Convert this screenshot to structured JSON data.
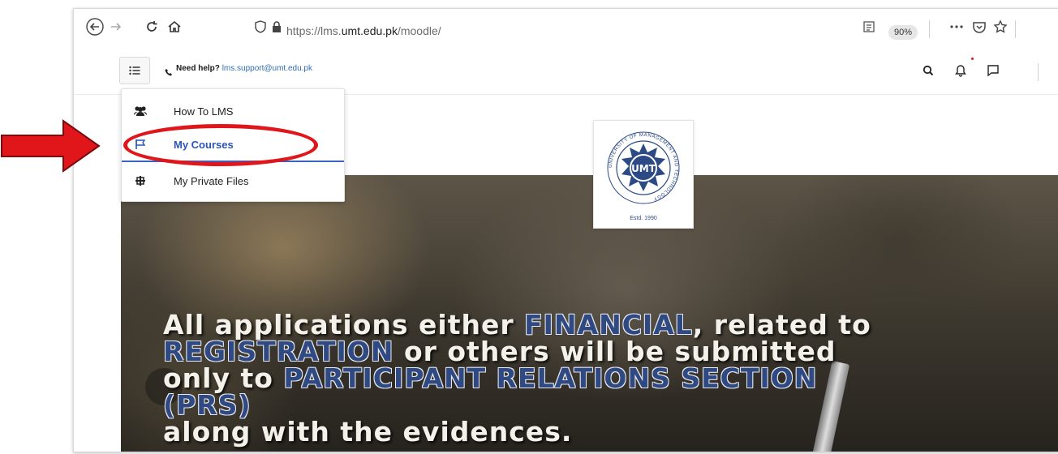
{
  "browser": {
    "url_prefix": "https://lms.",
    "url_domain": "umt.edu.pk",
    "url_suffix": "/moodle/",
    "zoom": "90%",
    "icons": [
      "back-icon",
      "forward-icon",
      "reload-icon",
      "home-icon",
      "shield-icon",
      "lock-icon",
      "reader-view-icon",
      "more-icon",
      "pocket-icon",
      "bookmark-star-icon"
    ]
  },
  "header": {
    "help_label": "Need help?",
    "help_email": "lms.support@umt.edu.pk",
    "icons": [
      "menu-icon",
      "phone-icon",
      "search-icon",
      "bell-icon",
      "chat-icon"
    ],
    "notification_color": "#e0161b"
  },
  "menu": {
    "items": [
      {
        "label": "How To LMS",
        "icon": "users-icon",
        "active": false
      },
      {
        "label": "My Courses",
        "icon": "flag-icon",
        "active": true
      },
      {
        "label": "My Private Files",
        "icon": "files-icon",
        "active": false
      }
    ]
  },
  "logo": {
    "text": "UMT",
    "ring_text": "UNIVERSITY OF MANAGEMENT AND TECHNOLOGY",
    "estd": "Estd. 1990",
    "color": "#2c4a86"
  },
  "banner": {
    "line1_a": "All applications either ",
    "line1_b": "FINANCIAL",
    "line1_c": ", related to",
    "line2_a": "REGISTRATION",
    "line2_b": " or others will be submitted",
    "line3_a": "only to ",
    "line3_b": "PARTICIPANT RELATIONS SECTION (PRS)",
    "line4": "along with the evidences."
  },
  "annotation": {
    "color": "#e0161b"
  }
}
